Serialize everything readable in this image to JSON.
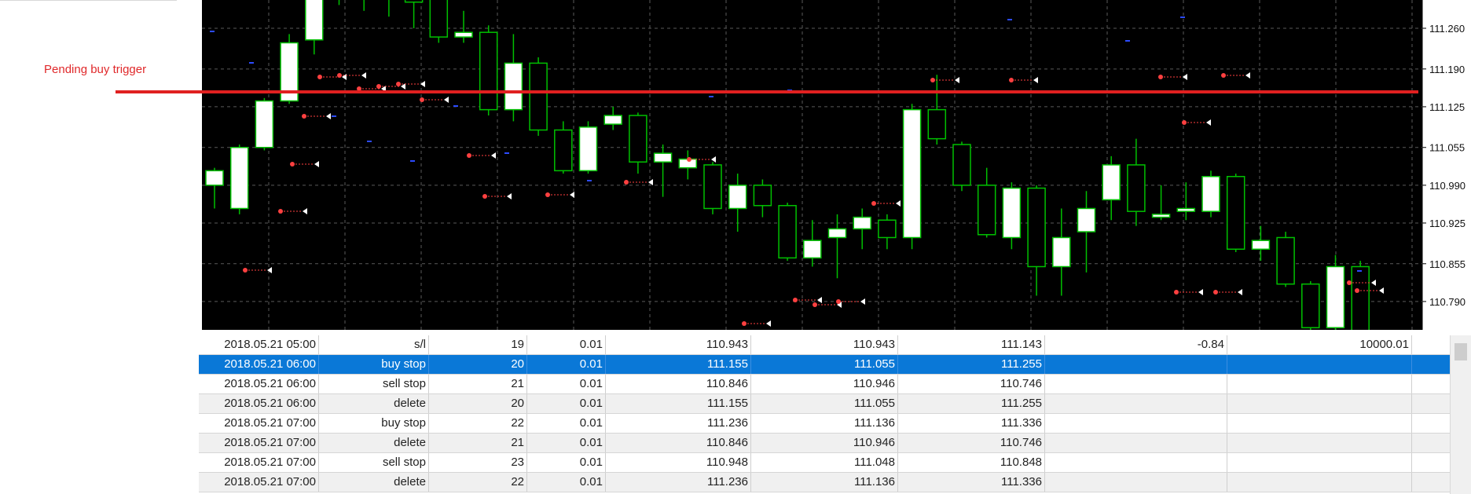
{
  "annotation": {
    "pending_label": "Pending buy trigger"
  },
  "colors": {
    "chart_bg": "#000000",
    "bull_candle": "#ffffff",
    "candle_outline": "#00c000",
    "trigger_line": "#e02020",
    "selection": "#0a78d7",
    "grid": "#5a5a5a",
    "axis_text": "#111111"
  },
  "chart": {
    "price_axis": [
      "111.260",
      "111.190",
      "111.125",
      "111.055",
      "110.990",
      "110.925",
      "110.855",
      "110.790"
    ],
    "pending_buy_trigger_price": 111.155,
    "candles": [
      {
        "o": 110.99,
        "c": 111.015,
        "h": 111.02,
        "l": 110.95
      },
      {
        "o": 110.95,
        "c": 111.055,
        "h": 111.06,
        "l": 110.94
      },
      {
        "o": 111.055,
        "c": 111.135,
        "h": 111.14,
        "l": 111.05
      },
      {
        "o": 111.135,
        "c": 111.235,
        "h": 111.25,
        "l": 111.13
      },
      {
        "o": 111.24,
        "c": 111.31,
        "h": 111.34,
        "l": 111.215
      },
      {
        "o": 111.32,
        "c": 111.38,
        "h": 111.4,
        "l": 111.3
      },
      {
        "o": 111.32,
        "c": 111.34,
        "h": 111.36,
        "l": 111.29
      },
      {
        "o": 111.34,
        "c": 111.31,
        "h": 111.37,
        "l": 111.28
      },
      {
        "o": 111.34,
        "c": 111.305,
        "h": 111.36,
        "l": 111.26
      },
      {
        "o": 111.31,
        "c": 111.245,
        "h": 111.33,
        "l": 111.235
      },
      {
        "o": 111.245,
        "c": 111.253,
        "h": 111.29,
        "l": 111.235
      },
      {
        "o": 111.253,
        "c": 111.12,
        "h": 111.265,
        "l": 111.11
      },
      {
        "o": 111.12,
        "c": 111.2,
        "h": 111.25,
        "l": 111.1
      },
      {
        "o": 111.2,
        "c": 111.085,
        "h": 111.21,
        "l": 111.075
      },
      {
        "o": 111.085,
        "c": 111.015,
        "h": 111.1,
        "l": 111.01
      },
      {
        "o": 111.015,
        "c": 111.09,
        "h": 111.1,
        "l": 111.01
      },
      {
        "o": 111.095,
        "c": 111.11,
        "h": 111.125,
        "l": 111.085
      },
      {
        "o": 111.11,
        "c": 111.03,
        "h": 111.115,
        "l": 111.01
      },
      {
        "o": 111.03,
        "c": 111.045,
        "h": 111.06,
        "l": 110.97
      },
      {
        "o": 111.02,
        "c": 111.035,
        "h": 111.05,
        "l": 111.0
      },
      {
        "o": 111.025,
        "c": 110.95,
        "h": 111.03,
        "l": 110.94
      },
      {
        "o": 110.95,
        "c": 110.99,
        "h": 111.01,
        "l": 110.91
      },
      {
        "o": 110.99,
        "c": 110.955,
        "h": 111.0,
        "l": 110.935
      },
      {
        "o": 110.955,
        "c": 110.865,
        "h": 110.96,
        "l": 110.86
      },
      {
        "o": 110.865,
        "c": 110.895,
        "h": 110.93,
        "l": 110.85
      },
      {
        "o": 110.9,
        "c": 110.915,
        "h": 110.94,
        "l": 110.83
      },
      {
        "o": 110.915,
        "c": 110.935,
        "h": 110.95,
        "l": 110.88
      },
      {
        "o": 110.93,
        "c": 110.9,
        "h": 110.94,
        "l": 110.88
      },
      {
        "o": 110.9,
        "c": 111.12,
        "h": 111.13,
        "l": 110.88
      },
      {
        "o": 111.12,
        "c": 111.07,
        "h": 111.18,
        "l": 111.06
      },
      {
        "o": 111.06,
        "c": 110.99,
        "h": 111.065,
        "l": 110.98
      },
      {
        "o": 110.99,
        "c": 110.905,
        "h": 111.02,
        "l": 110.9
      },
      {
        "o": 110.9,
        "c": 110.985,
        "h": 110.995,
        "l": 110.88
      },
      {
        "o": 110.985,
        "c": 110.85,
        "h": 110.99,
        "l": 110.8
      },
      {
        "o": 110.85,
        "c": 110.9,
        "h": 110.95,
        "l": 110.8
      },
      {
        "o": 110.91,
        "c": 110.95,
        "h": 110.98,
        "l": 110.84
      },
      {
        "o": 110.965,
        "c": 111.025,
        "h": 111.04,
        "l": 110.93
      },
      {
        "o": 111.025,
        "c": 110.945,
        "h": 111.07,
        "l": 110.92
      },
      {
        "o": 110.935,
        "c": 110.94,
        "h": 110.99,
        "l": 110.93
      },
      {
        "o": 110.945,
        "c": 110.95,
        "h": 110.995,
        "l": 110.93
      },
      {
        "o": 110.945,
        "c": 111.005,
        "h": 111.015,
        "l": 110.935
      },
      {
        "o": 111.005,
        "c": 110.88,
        "h": 111.01,
        "l": 110.875
      },
      {
        "o": 110.88,
        "c": 110.895,
        "h": 110.92,
        "l": 110.86
      },
      {
        "o": 110.9,
        "c": 110.82,
        "h": 110.91,
        "l": 110.815
      },
      {
        "o": 110.82,
        "c": 110.745,
        "h": 110.825,
        "l": 110.7
      },
      {
        "o": 110.745,
        "c": 110.85,
        "h": 110.87,
        "l": 110.74
      },
      {
        "o": 110.85,
        "c": 110.7,
        "h": 110.86,
        "l": 110.69
      }
    ]
  },
  "journal": {
    "rows": [
      [
        "2018.05.21 05:00",
        "s/l",
        "19",
        "0.01",
        "110.943",
        "110.943",
        "111.143",
        "-0.84",
        "10000.01"
      ],
      [
        "2018.05.21 06:00",
        "buy stop",
        "20",
        "0.01",
        "111.155",
        "111.055",
        "111.255",
        "",
        ""
      ],
      [
        "2018.05.21 06:00",
        "sell stop",
        "21",
        "0.01",
        "110.846",
        "110.946",
        "110.746",
        "",
        ""
      ],
      [
        "2018.05.21 06:00",
        "delete",
        "20",
        "0.01",
        "111.155",
        "111.055",
        "111.255",
        "",
        ""
      ],
      [
        "2018.05.21 07:00",
        "buy stop",
        "22",
        "0.01",
        "111.236",
        "111.136",
        "111.336",
        "",
        ""
      ],
      [
        "2018.05.21 07:00",
        "delete",
        "21",
        "0.01",
        "110.846",
        "110.946",
        "110.746",
        "",
        ""
      ],
      [
        "2018.05.21 07:00",
        "sell stop",
        "23",
        "0.01",
        "110.948",
        "111.048",
        "110.848",
        "",
        ""
      ],
      [
        "2018.05.21 07:00",
        "delete",
        "22",
        "0.01",
        "111.236",
        "111.136",
        "111.336",
        "",
        ""
      ]
    ],
    "selected_row": 1
  }
}
